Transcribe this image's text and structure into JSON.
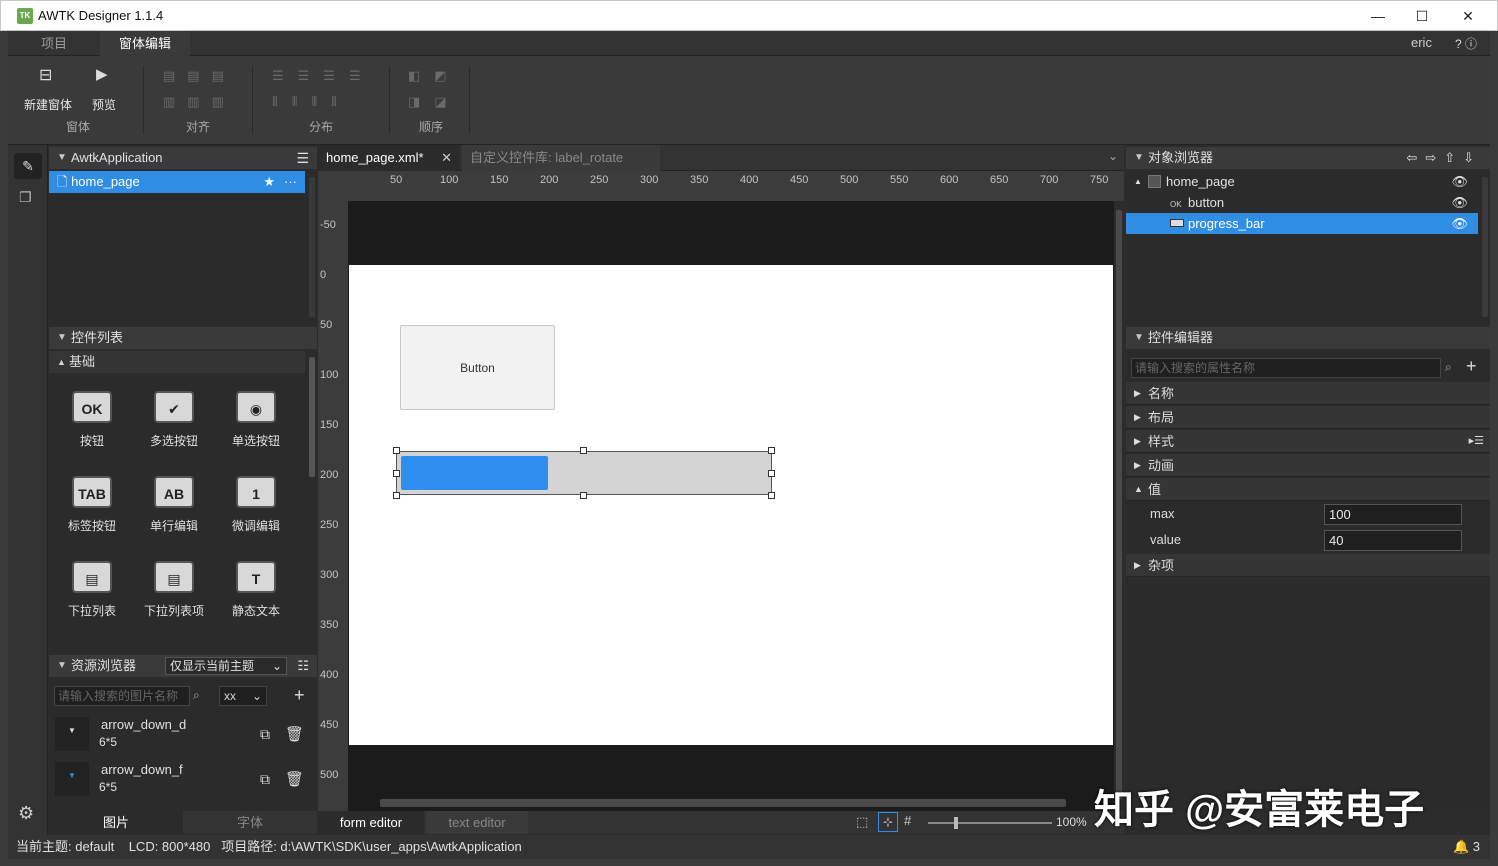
{
  "window": {
    "app_icon": "TK",
    "title": "AWTK Designer  1.1.4",
    "minimize": "—",
    "maximize": "☐",
    "close": "✕"
  },
  "menu_tabs": [
    "项目",
    "窗体编辑"
  ],
  "user": "eric",
  "toolbar": {
    "new_window_label": "新建窗体",
    "preview_label": "预览",
    "groups": [
      "窗体",
      "对齐",
      "分布",
      "顺序"
    ]
  },
  "app_panel": {
    "title": "AwtkApplication",
    "items": [
      "home_page"
    ]
  },
  "widget_list": {
    "title": "控件列表",
    "category": "基础",
    "widgets": [
      {
        "icon": "OK",
        "label": "按钮"
      },
      {
        "icon": "✔",
        "label": "多选按钮"
      },
      {
        "icon": "◉",
        "label": "单选按钮"
      },
      {
        "icon": "TAB",
        "label": "标签按钮"
      },
      {
        "icon": "AB",
        "label": "单行编辑"
      },
      {
        "icon": "1",
        "label": "微调编辑"
      },
      {
        "icon": "▤",
        "label": "下拉列表"
      },
      {
        "icon": "▤",
        "label": "下拉列表项"
      },
      {
        "icon": "T",
        "label": "静态文本"
      }
    ]
  },
  "resource_browser": {
    "title": "资源浏览器",
    "theme_filter": "仅显示当前主题",
    "search_placeholder": "请输入搜索的图片名称",
    "dpi_select": "xx",
    "items": [
      {
        "name": "arrow_down_d",
        "size": "6*5"
      },
      {
        "name": "arrow_down_f",
        "size": "6*5"
      }
    ],
    "tabs": [
      "图片",
      "字体"
    ]
  },
  "editor": {
    "tabs": [
      "home_page.xml*",
      "自定义控件库: label_rotate"
    ],
    "ruler_x": [
      "50",
      "100",
      "150",
      "200",
      "250",
      "300",
      "350",
      "400",
      "450",
      "500",
      "550",
      "600",
      "650",
      "700",
      "750"
    ],
    "ruler_y": [
      "-50",
      "0",
      "50",
      "100",
      "150",
      "200",
      "250",
      "300",
      "350",
      "400",
      "450",
      "500"
    ],
    "button_text": "Button",
    "progress_value": 0.4,
    "mode_tabs": [
      "form editor",
      "text editor"
    ],
    "zoom": "100%"
  },
  "object_browser": {
    "title": "对象浏览器",
    "root": "home_page",
    "children": [
      "button",
      "progress_bar"
    ]
  },
  "property_editor": {
    "title": "控件编辑器",
    "search_placeholder": "请输入搜索的属性名称",
    "sections": [
      "名称",
      "布局",
      "样式",
      "动画",
      "值",
      "杂项"
    ],
    "values": [
      {
        "key": "max",
        "value": "100"
      },
      {
        "key": "value",
        "value": "40"
      }
    ]
  },
  "status": {
    "text": "当前主题: default    LCD: 800*480   项目路径: d:\\AWTK\\SDK\\user_apps\\AwtkApplication",
    "notifications": "3"
  },
  "watermark": "知乎 @安富莱电子"
}
